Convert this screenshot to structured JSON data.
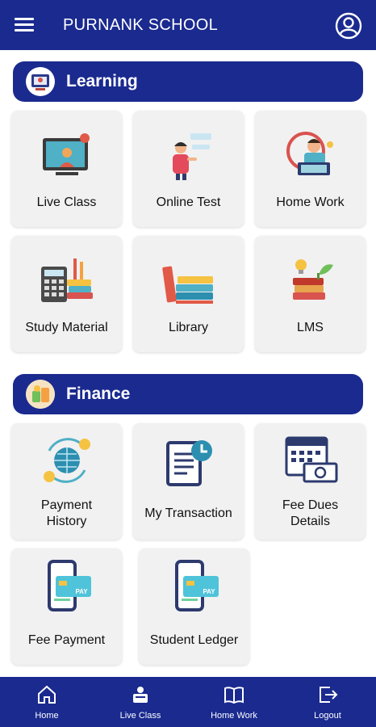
{
  "header": {
    "title": "PURNANK SCHOOL"
  },
  "sections": {
    "learning": {
      "title": "Learning",
      "items": [
        "Live Class",
        "Online Test",
        "Home Work",
        "Study Material",
        "Library",
        "LMS"
      ]
    },
    "finance": {
      "title": "Finance",
      "items": [
        "Payment\nHistory",
        "My Transaction",
        "Fee Dues\nDetails",
        "Fee Payment",
        "Student Ledger"
      ]
    }
  },
  "bottom_nav": [
    "Home",
    "Live Class",
    "Home Work",
    "Logout"
  ],
  "icons": {
    "menu": "menu-icon",
    "profile": "profile-icon",
    "learning": "learning-icon",
    "finance": "finance-icon"
  },
  "colors": {
    "primary": "#1a2a8f",
    "card_bg": "#f1f1f1"
  }
}
